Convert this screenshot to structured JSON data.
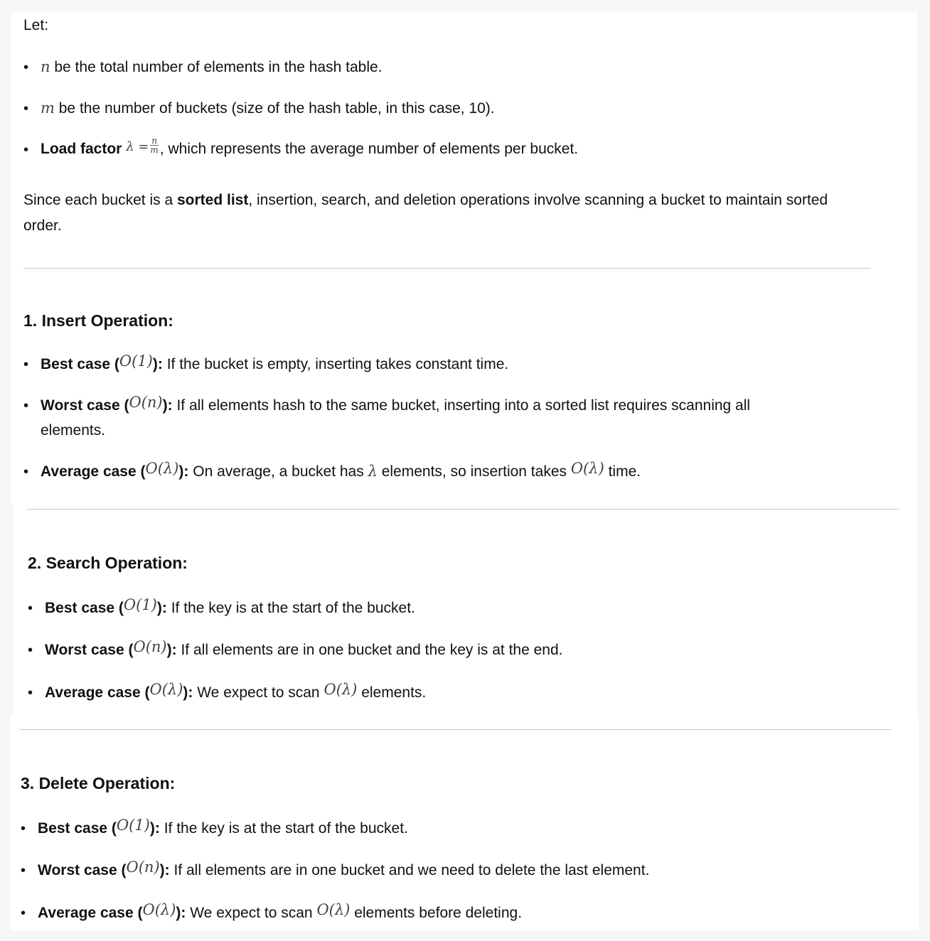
{
  "intro": {
    "let": "Let:",
    "items": [
      {
        "var": "n",
        "text": " be the total number of elements in the hash table."
      },
      {
        "var": "m",
        "text": " be the number of buckets (size of the hash table, in this case, 10)."
      }
    ],
    "load_factor": {
      "label": "Load factor",
      "math_lhs": "λ =",
      "num": "n",
      "den": "m",
      "text": ", which represents the average number of elements per bucket."
    },
    "para_pre": "Since each bucket is a ",
    "para_bold": "sorted list",
    "para_post": ", insertion, search, and deletion operations involve scanning a bucket to maintain sorted order."
  },
  "sections": [
    {
      "title": "1. Insert Operation:",
      "best": {
        "label": "Best case (",
        "math": "O(1)",
        "close": "):",
        "text": " If the bucket is empty, inserting takes constant time."
      },
      "worst": {
        "label": "Worst case (",
        "math": "O(n)",
        "close": "):",
        "text": " If all elements hash to the same bucket, inserting into a sorted list requires scanning all",
        "text2": "elements."
      },
      "avg": {
        "label": "Average case (",
        "math": "O(λ)",
        "close": "):",
        "text_a": " On average, a bucket has ",
        "math2": "λ",
        "text_b": " elements, so insertion takes ",
        "math3": "O(λ)",
        "text_c": " time."
      }
    },
    {
      "title": "2. Search Operation:",
      "best": {
        "label": "Best case (",
        "math": "O(1)",
        "close": "):",
        "text": " If the key is at the start of the bucket."
      },
      "worst": {
        "label": "Worst case (",
        "math": "O(n)",
        "close": "):",
        "text": " If all elements are in one bucket and the key is at the end."
      },
      "avg": {
        "label": "Average case (",
        "math": "O(λ)",
        "close": "):",
        "text_a": " We expect to scan ",
        "math3": "O(λ)",
        "text_c": " elements."
      }
    },
    {
      "title": "3. Delete Operation:",
      "best": {
        "label": "Best case (",
        "math": "O(1)",
        "close": "):",
        "text": " If the key is at the start of the bucket."
      },
      "worst": {
        "label": "Worst case (",
        "math": "O(n)",
        "close": "):",
        "text": " If all elements are in one bucket and we need to delete the last element."
      },
      "avg": {
        "label": "Average case (",
        "math": "O(λ)",
        "close": "):",
        "text_a": " We expect to scan ",
        "math3": "O(λ)",
        "text_c": " elements before deleting."
      }
    }
  ],
  "bullet_char": "•"
}
